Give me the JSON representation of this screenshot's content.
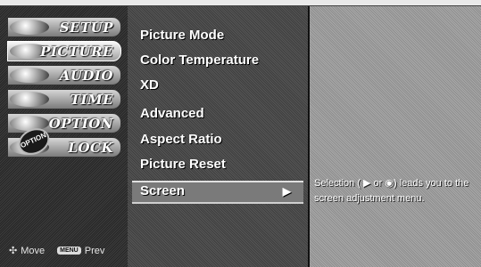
{
  "sidebar": {
    "items": [
      {
        "label": "SETUP"
      },
      {
        "label": "PICTURE"
      },
      {
        "label": "AUDIO"
      },
      {
        "label": "TIME"
      },
      {
        "label": "OPTION"
      },
      {
        "label": "LOCK"
      }
    ],
    "option_badge": "OPTION",
    "footer": {
      "move_icon": "✣",
      "move_label": "Move",
      "menu_key": "MENU",
      "prev_label": "Prev"
    }
  },
  "menu": {
    "items": [
      {
        "label": "Picture Mode"
      },
      {
        "label": "Color Temperature"
      },
      {
        "label": "XD"
      },
      {
        "label": "Advanced"
      },
      {
        "label": "Aspect Ratio"
      },
      {
        "label": "Picture Reset"
      },
      {
        "label": "Screen",
        "arrow": "▶"
      }
    ]
  },
  "help": {
    "text": "Selection ( ▶ or ◉) leads you to the screen adjustment menu."
  }
}
